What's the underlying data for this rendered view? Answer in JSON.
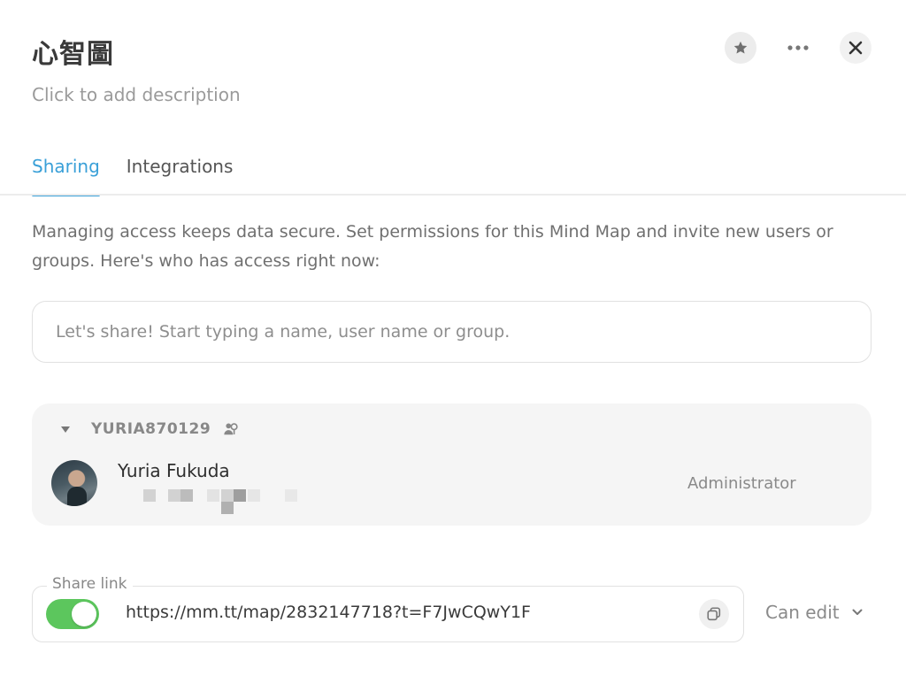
{
  "header": {
    "title": "心智圖",
    "description_placeholder": "Click to add description",
    "icons": {
      "favorite": "star-icon",
      "more": "more-horizontal-icon",
      "close": "close-icon"
    }
  },
  "tabs": [
    {
      "label": "Sharing",
      "active": true
    },
    {
      "label": "Integrations",
      "active": false
    }
  ],
  "sharing": {
    "intro": "Managing access keeps data secure. Set permissions for this Mind Map and invite new users or groups. Here's who has access right now:",
    "search_placeholder": "Let's share! Start typing a name, user name or group.",
    "group": {
      "name": "YURIA870129",
      "icon": "group-icon",
      "members": [
        {
          "name": "Yuria Fukuda",
          "role": "Administrator"
        }
      ]
    },
    "share_link": {
      "legend": "Share link",
      "enabled": true,
      "url": "https://mm.tt/map/2832147718?t=F7JwCQwY1F",
      "permission": "Can edit"
    }
  },
  "colors": {
    "accent": "#3aa0d8",
    "toggle_on": "#5cc65d"
  }
}
